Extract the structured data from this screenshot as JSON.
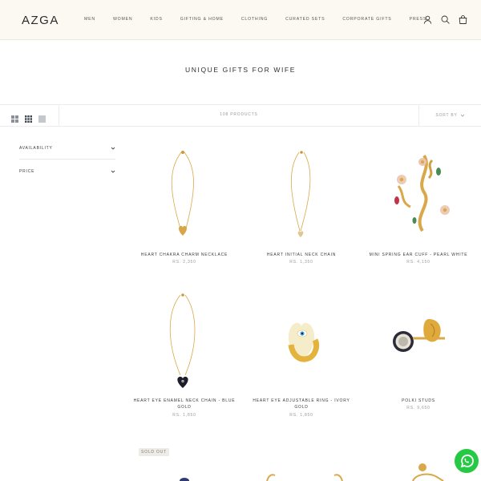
{
  "header": {
    "logo": "AZGA",
    "nav": [
      "MEN",
      "WOMEN",
      "KIDS",
      "GIFTING & HOME",
      "CLOTHING",
      "CURATED SETS",
      "CORPORATE GIFTS",
      "PRESS"
    ],
    "icons": [
      "account-icon",
      "search-icon",
      "bag-icon"
    ]
  },
  "page": {
    "title": "UNIQUE GIFTS FOR WIFE"
  },
  "toolbar": {
    "product_count": "108 PRODUCTS",
    "sort_label": "SORT BY"
  },
  "filters": [
    {
      "label": "AVAILABILITY"
    },
    {
      "label": "PRICE"
    }
  ],
  "products": [
    {
      "name": "HEART CHAKRA CHARM NECKLACE",
      "price": "RS. 2,350"
    },
    {
      "name": "HEART INITIAL NECK CHAIN",
      "price": "RS. 1,350"
    },
    {
      "name": "MINI SPRING EAR CUFF - PEARL WHITE",
      "price": "RS. 4,150"
    },
    {
      "name": "HEART EYE ENAMEL NECK CHAIN - BLUE GOLD",
      "price": "RS. 1,850"
    },
    {
      "name": "HEART EYE ADJUSTABLE RING - IVORY GOLD",
      "price": "RS. 1,850"
    },
    {
      "name": "POLKI STUDS",
      "price": "RS. 9,650"
    }
  ],
  "badges": {
    "sold_out": "SOLD OUT"
  },
  "colors": {
    "header_bg": "#fbf9f1",
    "gold": "#d9a84a",
    "whatsapp": "#26c943"
  }
}
